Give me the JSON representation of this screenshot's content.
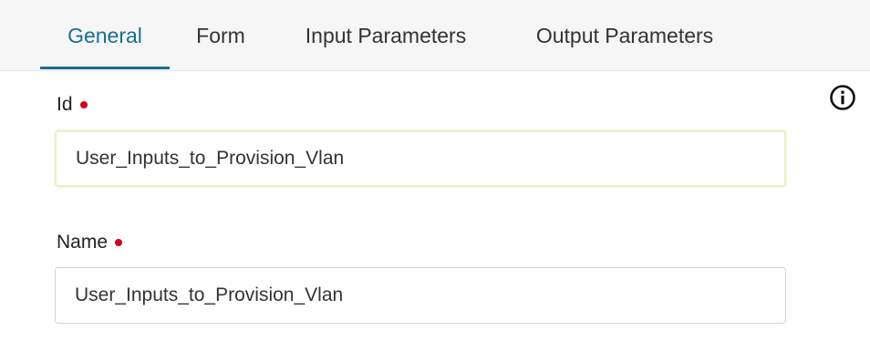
{
  "tabs": [
    {
      "label": "General",
      "active": true
    },
    {
      "label": "Form",
      "active": false
    },
    {
      "label": "Input Parameters",
      "active": false
    },
    {
      "label": "Output Parameters",
      "active": false
    }
  ],
  "fields": {
    "id": {
      "label": "Id",
      "value": "User_Inputs_to_Provision_Vlan",
      "required": true
    },
    "name": {
      "label": "Name",
      "value": "User_Inputs_to_Provision_Vlan",
      "required": true
    }
  },
  "icons": {
    "info": "info-circle-icon",
    "required": "required-dot"
  },
  "colors": {
    "accent": "#1a6e93",
    "required": "#d0021b",
    "focus_border": "#e8f2c4"
  }
}
